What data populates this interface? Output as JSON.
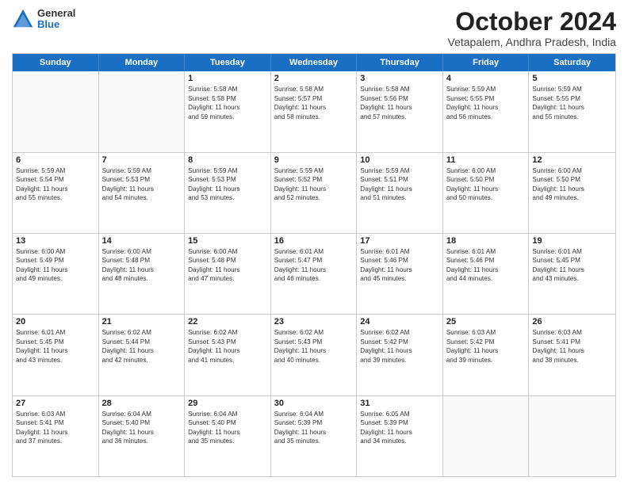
{
  "logo": {
    "general": "General",
    "blue": "Blue"
  },
  "title": "October 2024",
  "location": "Vetapalem, Andhra Pradesh, India",
  "days_of_week": [
    "Sunday",
    "Monday",
    "Tuesday",
    "Wednesday",
    "Thursday",
    "Friday",
    "Saturday"
  ],
  "weeks": [
    [
      {
        "day": "",
        "lines": []
      },
      {
        "day": "",
        "lines": []
      },
      {
        "day": "1",
        "lines": [
          "Sunrise: 5:58 AM",
          "Sunset: 5:58 PM",
          "Daylight: 11 hours",
          "and 59 minutes."
        ]
      },
      {
        "day": "2",
        "lines": [
          "Sunrise: 5:58 AM",
          "Sunset: 5:57 PM",
          "Daylight: 11 hours",
          "and 58 minutes."
        ]
      },
      {
        "day": "3",
        "lines": [
          "Sunrise: 5:58 AM",
          "Sunset: 5:56 PM",
          "Daylight: 11 hours",
          "and 57 minutes."
        ]
      },
      {
        "day": "4",
        "lines": [
          "Sunrise: 5:59 AM",
          "Sunset: 5:55 PM",
          "Daylight: 11 hours",
          "and 56 minutes."
        ]
      },
      {
        "day": "5",
        "lines": [
          "Sunrise: 5:59 AM",
          "Sunset: 5:55 PM",
          "Daylight: 11 hours",
          "and 55 minutes."
        ]
      }
    ],
    [
      {
        "day": "6",
        "lines": [
          "Sunrise: 5:59 AM",
          "Sunset: 5:54 PM",
          "Daylight: 11 hours",
          "and 55 minutes."
        ]
      },
      {
        "day": "7",
        "lines": [
          "Sunrise: 5:59 AM",
          "Sunset: 5:53 PM",
          "Daylight: 11 hours",
          "and 54 minutes."
        ]
      },
      {
        "day": "8",
        "lines": [
          "Sunrise: 5:59 AM",
          "Sunset: 5:53 PM",
          "Daylight: 11 hours",
          "and 53 minutes."
        ]
      },
      {
        "day": "9",
        "lines": [
          "Sunrise: 5:59 AM",
          "Sunset: 5:52 PM",
          "Daylight: 11 hours",
          "and 52 minutes."
        ]
      },
      {
        "day": "10",
        "lines": [
          "Sunrise: 5:59 AM",
          "Sunset: 5:51 PM",
          "Daylight: 11 hours",
          "and 51 minutes."
        ]
      },
      {
        "day": "11",
        "lines": [
          "Sunrise: 6:00 AM",
          "Sunset: 5:50 PM",
          "Daylight: 11 hours",
          "and 50 minutes."
        ]
      },
      {
        "day": "12",
        "lines": [
          "Sunrise: 6:00 AM",
          "Sunset: 5:50 PM",
          "Daylight: 11 hours",
          "and 49 minutes."
        ]
      }
    ],
    [
      {
        "day": "13",
        "lines": [
          "Sunrise: 6:00 AM",
          "Sunset: 5:49 PM",
          "Daylight: 11 hours",
          "and 49 minutes."
        ]
      },
      {
        "day": "14",
        "lines": [
          "Sunrise: 6:00 AM",
          "Sunset: 5:48 PM",
          "Daylight: 11 hours",
          "and 48 minutes."
        ]
      },
      {
        "day": "15",
        "lines": [
          "Sunrise: 6:00 AM",
          "Sunset: 5:48 PM",
          "Daylight: 11 hours",
          "and 47 minutes."
        ]
      },
      {
        "day": "16",
        "lines": [
          "Sunrise: 6:01 AM",
          "Sunset: 5:47 PM",
          "Daylight: 11 hours",
          "and 46 minutes."
        ]
      },
      {
        "day": "17",
        "lines": [
          "Sunrise: 6:01 AM",
          "Sunset: 5:46 PM",
          "Daylight: 11 hours",
          "and 45 minutes."
        ]
      },
      {
        "day": "18",
        "lines": [
          "Sunrise: 6:01 AM",
          "Sunset: 5:46 PM",
          "Daylight: 11 hours",
          "and 44 minutes."
        ]
      },
      {
        "day": "19",
        "lines": [
          "Sunrise: 6:01 AM",
          "Sunset: 5:45 PM",
          "Daylight: 11 hours",
          "and 43 minutes."
        ]
      }
    ],
    [
      {
        "day": "20",
        "lines": [
          "Sunrise: 6:01 AM",
          "Sunset: 5:45 PM",
          "Daylight: 11 hours",
          "and 43 minutes."
        ]
      },
      {
        "day": "21",
        "lines": [
          "Sunrise: 6:02 AM",
          "Sunset: 5:44 PM",
          "Daylight: 11 hours",
          "and 42 minutes."
        ]
      },
      {
        "day": "22",
        "lines": [
          "Sunrise: 6:02 AM",
          "Sunset: 5:43 PM",
          "Daylight: 11 hours",
          "and 41 minutes."
        ]
      },
      {
        "day": "23",
        "lines": [
          "Sunrise: 6:02 AM",
          "Sunset: 5:43 PM",
          "Daylight: 11 hours",
          "and 40 minutes."
        ]
      },
      {
        "day": "24",
        "lines": [
          "Sunrise: 6:02 AM",
          "Sunset: 5:42 PM",
          "Daylight: 11 hours",
          "and 39 minutes."
        ]
      },
      {
        "day": "25",
        "lines": [
          "Sunrise: 6:03 AM",
          "Sunset: 5:42 PM",
          "Daylight: 11 hours",
          "and 39 minutes."
        ]
      },
      {
        "day": "26",
        "lines": [
          "Sunrise: 6:03 AM",
          "Sunset: 5:41 PM",
          "Daylight: 11 hours",
          "and 38 minutes."
        ]
      }
    ],
    [
      {
        "day": "27",
        "lines": [
          "Sunrise: 6:03 AM",
          "Sunset: 5:41 PM",
          "Daylight: 11 hours",
          "and 37 minutes."
        ]
      },
      {
        "day": "28",
        "lines": [
          "Sunrise: 6:04 AM",
          "Sunset: 5:40 PM",
          "Daylight: 11 hours",
          "and 36 minutes."
        ]
      },
      {
        "day": "29",
        "lines": [
          "Sunrise: 6:04 AM",
          "Sunset: 5:40 PM",
          "Daylight: 11 hours",
          "and 35 minutes."
        ]
      },
      {
        "day": "30",
        "lines": [
          "Sunrise: 6:04 AM",
          "Sunset: 5:39 PM",
          "Daylight: 11 hours",
          "and 35 minutes."
        ]
      },
      {
        "day": "31",
        "lines": [
          "Sunrise: 6:05 AM",
          "Sunset: 5:39 PM",
          "Daylight: 11 hours",
          "and 34 minutes."
        ]
      },
      {
        "day": "",
        "lines": []
      },
      {
        "day": "",
        "lines": []
      }
    ]
  ]
}
